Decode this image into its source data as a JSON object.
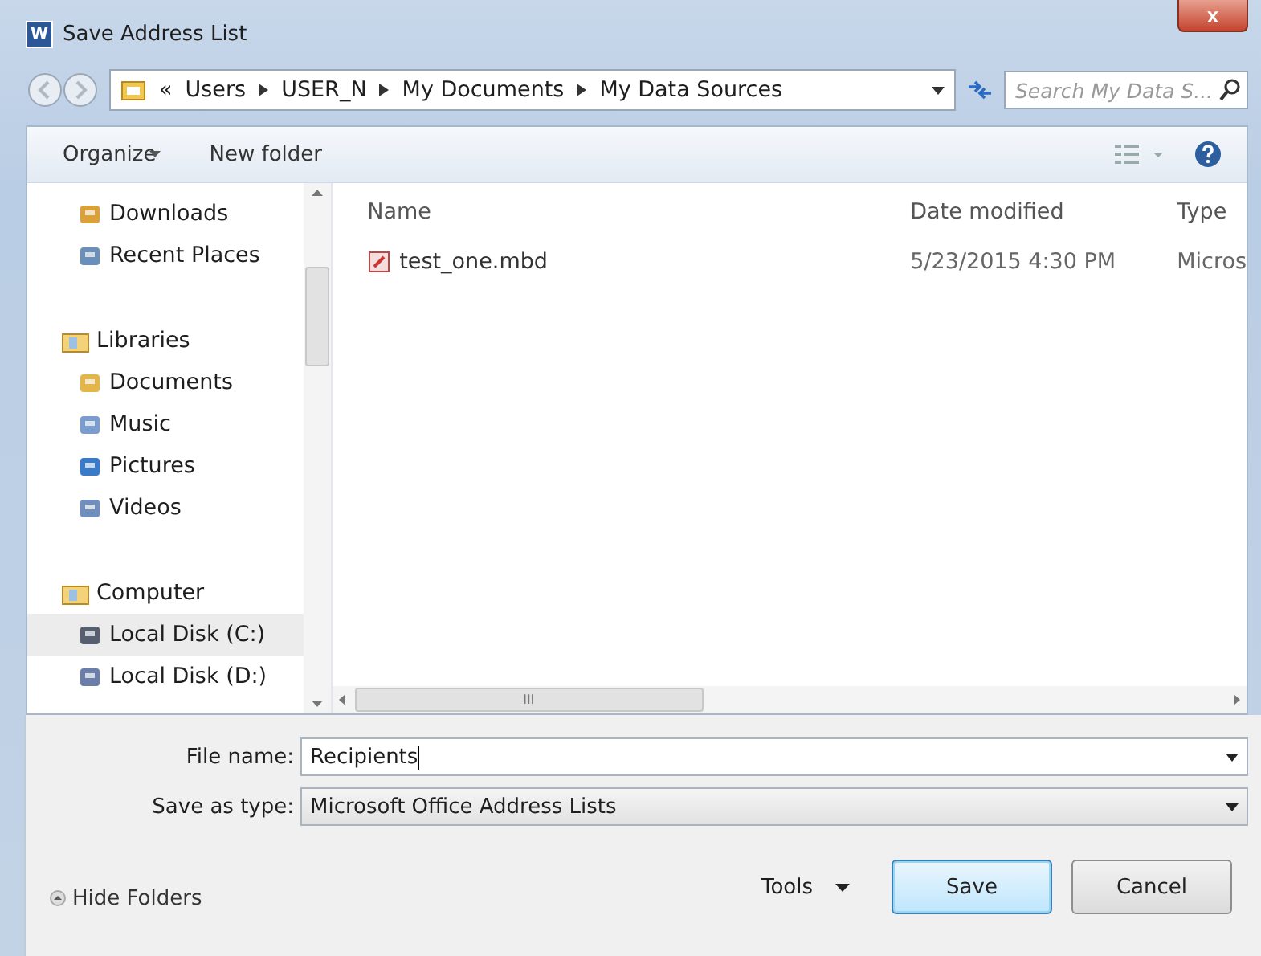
{
  "window": {
    "app_icon": "W",
    "title": "Save Address List",
    "close": "x"
  },
  "address_bar": {
    "overflow": "«",
    "path": [
      "Users",
      "USER_N",
      "My Documents",
      "My Data Sources"
    ]
  },
  "search": {
    "placeholder": "Search My Data S..."
  },
  "toolbar": {
    "organize": "Organize",
    "new_folder": "New folder"
  },
  "sidebar": {
    "sections": [
      {
        "items": [
          {
            "label": "Downloads",
            "selected": false
          },
          {
            "label": "Recent Places",
            "selected": false
          }
        ]
      },
      {
        "heading": "Libraries",
        "items": [
          {
            "label": "Documents",
            "selected": false
          },
          {
            "label": "Music",
            "selected": false
          },
          {
            "label": "Pictures",
            "selected": false
          },
          {
            "label": "Videos",
            "selected": false
          }
        ]
      },
      {
        "heading": "Computer",
        "items": [
          {
            "label": "Local Disk (C:)",
            "selected": true
          },
          {
            "label": "Local Disk (D:)",
            "selected": false
          }
        ]
      }
    ]
  },
  "table": {
    "columns": [
      "Name",
      "Date modified",
      "Type"
    ],
    "rows": [
      {
        "name": "test_one.mbd",
        "date": "5/23/2015 4:30 PM",
        "type": "Micros"
      }
    ],
    "scroll_grip": "III"
  },
  "form": {
    "file_name_label": "File name:",
    "file_name": "Recipients",
    "type_label": "Save as type:",
    "type_value": "Microsoft Office Address Lists"
  },
  "footer": {
    "hide_folders": "Hide Folders",
    "tools": "Tools",
    "buttons": [
      {
        "label": "Save",
        "default": true
      },
      {
        "label": "Cancel",
        "default": false
      }
    ]
  }
}
